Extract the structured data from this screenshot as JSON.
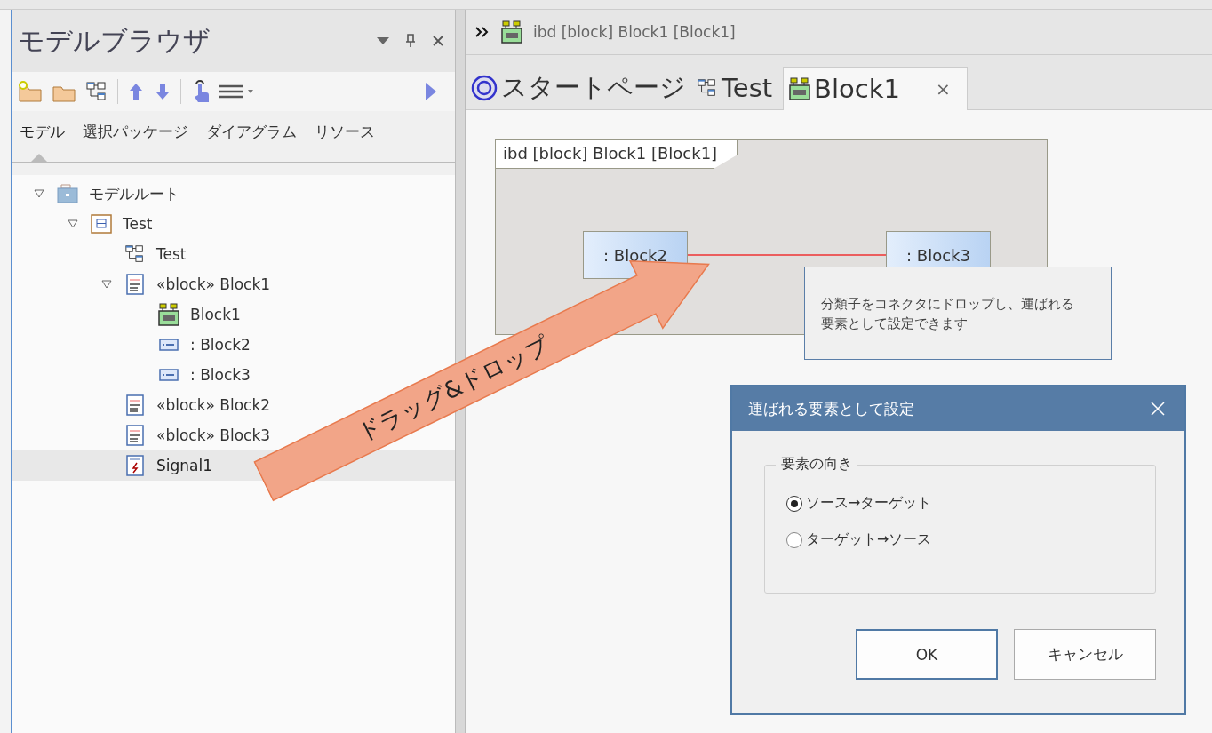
{
  "browser": {
    "title": "モデルブラウザ",
    "tabs": [
      {
        "label": "モデル",
        "selected": true
      },
      {
        "label": "選択パッケージ",
        "selected": false
      },
      {
        "label": "ダイアグラム",
        "selected": false
      },
      {
        "label": "リソース",
        "selected": false
      }
    ],
    "tree": [
      {
        "label": "モデルルート",
        "kind": "root",
        "expanded": true,
        "selected": false,
        "children": [
          {
            "label": "Test",
            "kind": "package",
            "expanded": true,
            "selected": false,
            "children": [
              {
                "label": "Test",
                "kind": "diagram",
                "selected": false
              },
              {
                "label": "«block» Block1",
                "kind": "block",
                "expanded": true,
                "selected": false,
                "children": [
                  {
                    "label": "Block1",
                    "kind": "ibd",
                    "selected": false
                  },
                  {
                    "label": ": Block2",
                    "kind": "part",
                    "selected": false
                  },
                  {
                    "label": ": Block3",
                    "kind": "part",
                    "selected": false
                  }
                ]
              },
              {
                "label": "«block» Block2",
                "kind": "block",
                "selected": false
              },
              {
                "label": "«block» Block3",
                "kind": "block",
                "selected": false
              },
              {
                "label": "Signal1",
                "kind": "signal",
                "selected": true
              }
            ]
          }
        ]
      }
    ]
  },
  "editor": {
    "breadcrumb": "ibd [block] Block1 [Block1]",
    "tabs": [
      {
        "label": "スタートページ",
        "kind": "start",
        "selected": false
      },
      {
        "label": "Test",
        "kind": "diagram",
        "selected": false
      },
      {
        "label": "Block1",
        "kind": "ibd",
        "selected": true,
        "close": "×"
      }
    ]
  },
  "diagram": {
    "frame_label": "ibd [block] Block1 [Block1]",
    "parts": [
      ": Block2",
      ": Block3"
    ],
    "tooltip_lines": [
      "分類子をコネクタにドロップし、運ばれる",
      "要素として設定できます"
    ]
  },
  "annotation": "ドラッグ&ドロップ",
  "dialog": {
    "title": "運ばれる要素として設定",
    "group": "要素の向き",
    "options": [
      {
        "label": "ソース→ターゲット",
        "selected": true
      },
      {
        "label": "ターゲット→ソース",
        "selected": false
      }
    ],
    "buttons": [
      "OK",
      "キャンセル"
    ]
  }
}
